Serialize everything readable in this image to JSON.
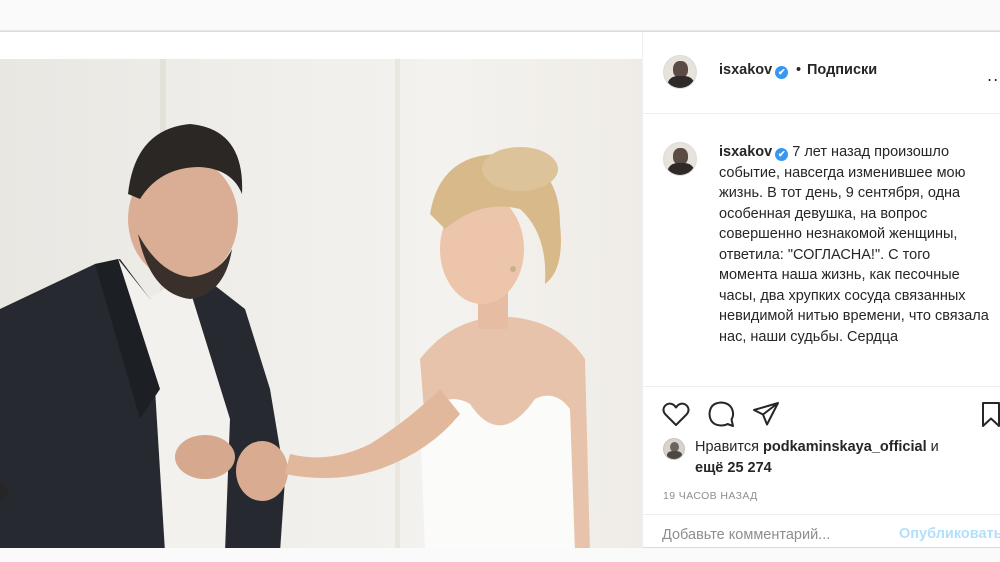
{
  "post": {
    "author": "isxakov",
    "follow_separator": "•",
    "follow_label": "Подписки",
    "more_label": "...",
    "caption": "7 лет назад произошло событие, навсегда изменившее мою жизнь. В тот день, 9 сентября, одна особенная девушка, на вопрос совершенно незнакомой женщины, ответила: \"СОГЛАСНА!\". С того момента наша жизнь, как песочные часы, два хрупких сосуда связанных невидимой нитью времени, что связала нас, наши судьбы. Сердца",
    "verified_mark": "✔",
    "likes_prefix": "Нравится",
    "likes_user": "podkaminskaya_official",
    "likes_and": "и",
    "likes_more": "ещё 25 274",
    "time_ago": "19 ЧАСОВ НАЗАД",
    "comment_placeholder": "Добавьте комментарий...",
    "publish_label": "Опубликовать"
  },
  "icons": {
    "like": "heart-icon",
    "comment": "comment-icon",
    "share": "share-icon",
    "save": "bookmark-icon",
    "verified": "verified-badge-icon",
    "more": "more-options-icon",
    "nav": "carousel-dot"
  },
  "colors": {
    "verified": "#3897f0",
    "publish_disabled": "#b2dffc",
    "muted_text": "#8e8e8e"
  }
}
